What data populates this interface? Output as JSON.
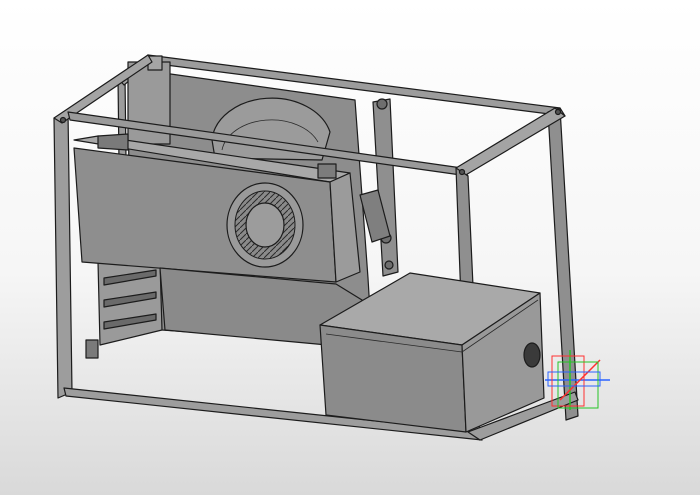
{
  "viewport": {
    "background": "#f2f2f2",
    "model": {
      "name": "pc-case-assembly",
      "parts": [
        "frame",
        "gpu-card",
        "gpu-fan",
        "radiator-fan",
        "motherboard",
        "pci-brackets",
        "power-supply",
        "psu-fan-hole"
      ],
      "colors": {
        "part_fill": "#8a8a8a",
        "part_light": "#a9a9a9",
        "part_dark": "#6e6e6e",
        "edge": "#1c1c1c"
      }
    },
    "triad": {
      "x_axis_color": "#ff3030",
      "y_axis_color": "#25c425",
      "z_axis_color": "#2a63ff"
    }
  }
}
